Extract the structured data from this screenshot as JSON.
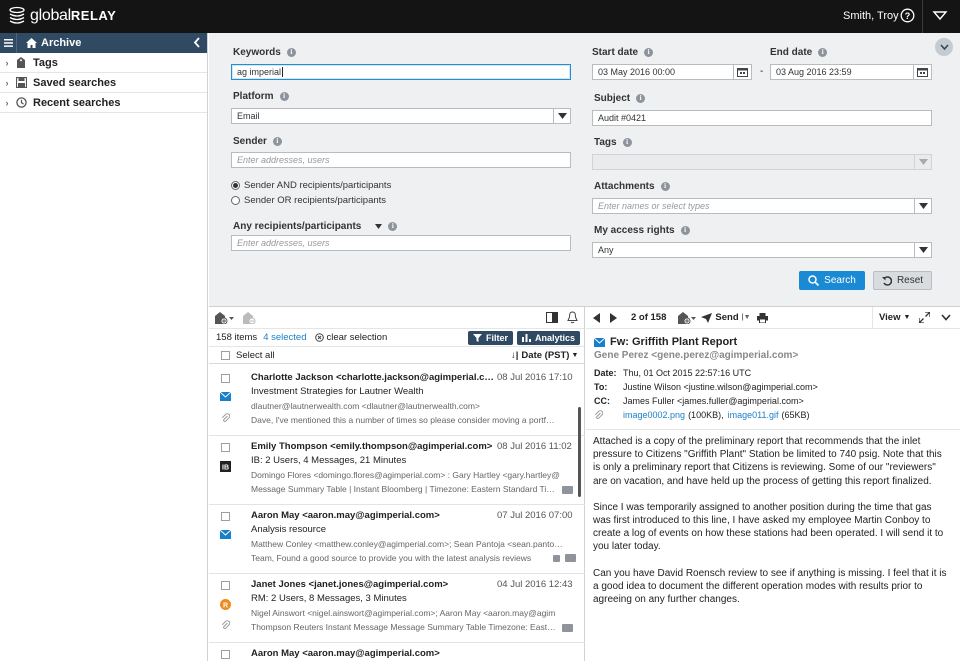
{
  "topbar": {
    "logo_main": "global",
    "logo_bold": "RELAY",
    "user_name": "Smith, Troy"
  },
  "sidebar": {
    "title": "Archive",
    "items": [
      {
        "label": "Tags",
        "icon": "tag-icon"
      },
      {
        "label": "Saved searches",
        "icon": "save-icon"
      },
      {
        "label": "Recent searches",
        "icon": "clock-icon"
      }
    ]
  },
  "search": {
    "keywords_label": "Keywords",
    "keywords_value": "ag imperial",
    "platform_label": "Platform",
    "platform_value": "Email",
    "sender_label": "Sender",
    "sender_placeholder": "Enter addresses, users",
    "radio_and": "Sender AND recipients/participants",
    "radio_or": "Sender OR recipients/participants",
    "any_label": "Any recipients/participants",
    "any_placeholder": "Enter addresses, users",
    "start_label": "Start date",
    "start_value": "03 May 2016 00:00",
    "end_label": "End date",
    "end_value": "03 Aug 2016 23:59",
    "date_sep": "-",
    "subject_label": "Subject",
    "subject_value": "Audit #0421",
    "tags_label": "Tags",
    "attachments_label": "Attachments",
    "attachments_placeholder": "Enter names or select types",
    "access_label": "My access rights",
    "access_value": "Any",
    "search_btn": "Search",
    "reset_btn": "Reset"
  },
  "list": {
    "count": "158 items",
    "selected": "4 selected",
    "clear": "clear selection",
    "filter_btn": "Filter",
    "analytics_btn": "Analytics",
    "select_all": "Select all",
    "sort_label": "Date (PST)",
    "items": [
      {
        "from": "Charlotte Jackson <charlotte.jackson@agimperial.com>",
        "date": "08 Jul 2016 17:10",
        "subject": "Investment Strategies for Lautner Wealth",
        "line3": "dlautner@lautnerwealth.com <dlautner@lautnerwealth.com>",
        "line4": "Dave, I've mentioned this a number of times so please consider moving a portfolio",
        "type_icon": "envelope-icon"
      },
      {
        "from": "Emily Thompson <emily.thompson@agimperial.com>",
        "date": "08 Jul 2016 11:02",
        "subject": "IB: 2 Users, 4 Messages, 21 Minutes",
        "line3": "Domingo Flores <domingo.flores@agimperial.com> : Gary Hartley <gary.hartley@",
        "line4": "Message Summary Table | Instant Bloomberg | Timezone: Eastern Standard Time",
        "type_icon": "bloomberg-icon"
      },
      {
        "from": "Aaron May <aaron.may@agimperial.com>",
        "date": "07 Jul 2016 07:00",
        "subject": "Analysis resource",
        "line3": "Matthew Conley <matthew.conley@agimperial.com>; Sean Pantoja <sean.pantoja@",
        "line4": "Team, Found a good source to provide you with the latest analysis reviews",
        "type_icon": "envelope-icon"
      },
      {
        "from": "Janet Jones <janet.jones@agimperial.com>",
        "date": "04 Jul 2016 12:43",
        "subject": "RM: 2 Users, 8 Messages, 3 Minutes",
        "line3": "Nigel Ainswort <nigel.ainswort@agimperial.com>; Aaron May <aaron.may@agim",
        "line4": "Thompson Reuters Instant Message Message Summary Table Timezone: Eastern",
        "type_icon": "reuters-icon"
      },
      {
        "from": "Aaron May <aaron.may@agimperial.com>",
        "date": "",
        "subject": "",
        "line3": "",
        "line4": "",
        "type_icon": ""
      }
    ]
  },
  "preview": {
    "position": "2 of 158",
    "send": "Send",
    "view": "View",
    "title": "Fw: Griffith Plant Report",
    "sender": "Gene Perez <gene.perez@agimperial.com>",
    "date_k": "Date:",
    "date_v": "Thu, 01 Oct 2015 22:57:16 UTC",
    "to_k": "To:",
    "to_v": "Justine Wilson <justine.wilson@agimperial.com>",
    "cc_k": "CC:",
    "cc_v": "James Fuller <james.fuller@agimperial.com>",
    "att1": "image0002.png",
    "att1_size": "(100KB),",
    "att2": "image011.gif",
    "att2_size": "(65KB)",
    "body": [
      "Attached is a copy of the preliminary report that  recommends that the inlet pressure to Citizens \"Griffith Plant\" Station be  limited to 740 psig. Note that this is only a preliminary report that  Citizens is reviewing. Some of our \"reviewers\" are on vacation, and have  held up the process of getting this report finalized.",
      "Since  I was temporarily assigned to another position during the time that gas was first introduced to this line, I have asked my employee Martin Conboy to create a log  of events on how these stations had been operated.  I will send it to you  later today.",
      "Can  you have David Roensch review to see if anything is missing.  I feel that  it is a good idea to document the different operation modes with results prior  to agreeing on any further changes."
    ]
  },
  "colors": {
    "topbar": "#141414",
    "sidebar_header": "#2f4a62",
    "accent": "#1a8ad4",
    "panel": "#eef0f2"
  }
}
